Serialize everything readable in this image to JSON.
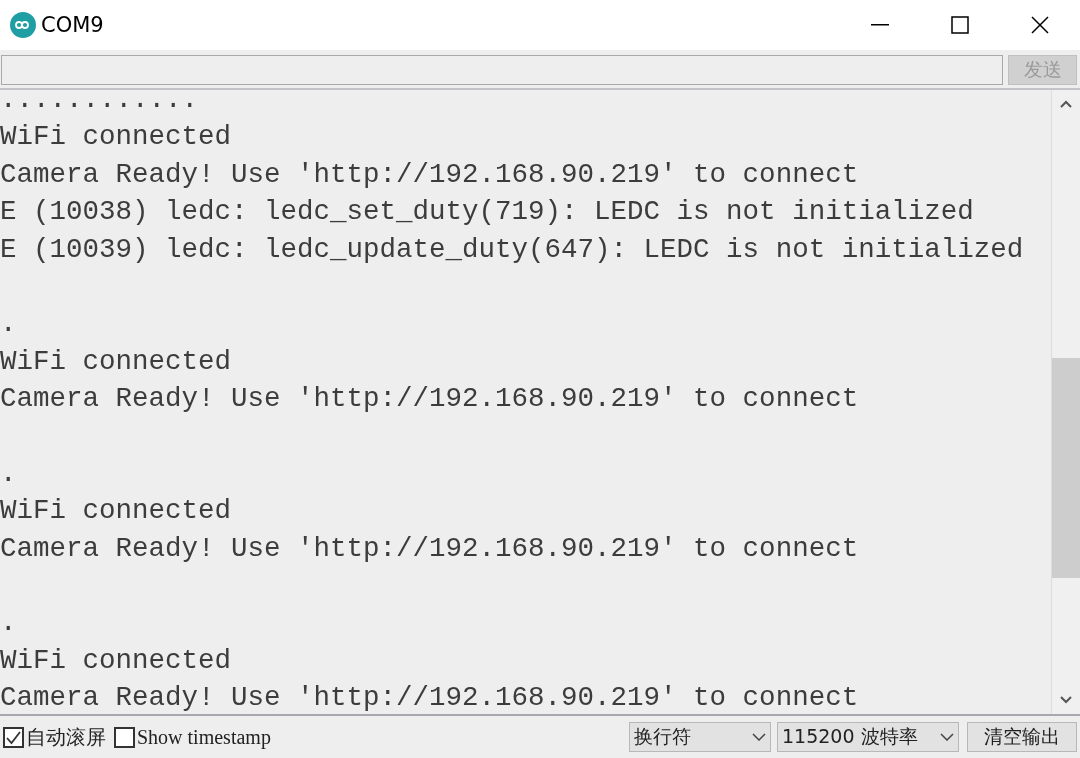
{
  "window": {
    "title": "COM9"
  },
  "send_button": {
    "label": "发送",
    "disabled": true
  },
  "output": {
    "blocks": [
      {
        "lines": [
          "............",
          "WiFi connected",
          "Camera Ready! Use 'http://192.168.90.219' to connect",
          "E (10038) ledc: ledc_set_duty(719): LEDC is not initialized",
          "E (10039) ledc: ledc_update_duty(647): LEDC is not initialized"
        ]
      },
      {
        "lines": [
          ".",
          "WiFi connected",
          "Camera Ready! Use 'http://192.168.90.219' to connect"
        ]
      },
      {
        "lines": [
          ".",
          "WiFi connected",
          "Camera Ready! Use 'http://192.168.90.219' to connect"
        ]
      },
      {
        "lines": [
          ".",
          "WiFi connected",
          "Camera Ready! Use 'http://192.168.90.219' to connect"
        ]
      }
    ]
  },
  "options": [
    {
      "label": "自动滚屏",
      "checked": true
    },
    {
      "label": "Show timestamp",
      "checked": false
    }
  ],
  "dropdowns": [
    {
      "value": "换行符"
    },
    {
      "value": "115200 波特率"
    }
  ],
  "clear_button": {
    "label": "清空输出"
  }
}
